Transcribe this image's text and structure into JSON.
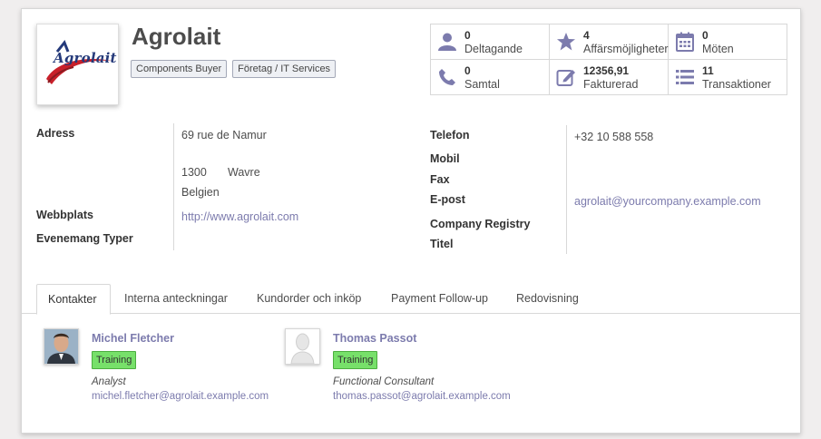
{
  "company": {
    "name": "Agrolait",
    "logo_text": "Agrolait",
    "tags": [
      "Components Buyer",
      "Företag / IT Services"
    ]
  },
  "stats": [
    {
      "icon": "user-icon",
      "count": "0",
      "label": "Deltagande"
    },
    {
      "icon": "star-icon",
      "count": "4",
      "label": "Affärsmöjligheter"
    },
    {
      "icon": "calendar-icon",
      "count": "0",
      "label": "Möten"
    },
    {
      "icon": "phone-icon",
      "count": "0",
      "label": "Samtal"
    },
    {
      "icon": "pencil-square-icon",
      "count": "12356,91",
      "label": "Fakturerad"
    },
    {
      "icon": "list-icon",
      "count": "11",
      "label": "Transaktioner"
    }
  ],
  "left_fields": {
    "address_label": "Adress",
    "street": "69 rue de Namur",
    "zip": "1300",
    "city": "Wavre",
    "country": "Belgien",
    "website_label": "Webbplats",
    "website": "http://www.agrolait.com",
    "event_types_label": "Evenemang Typer"
  },
  "right_fields": {
    "phone_label": "Telefon",
    "phone": "+32 10 588 558",
    "mobile_label": "Mobil",
    "fax_label": "Fax",
    "email_label": "E-post",
    "email": "agrolait@yourcompany.example.com",
    "registry_label": "Company Registry",
    "title_label": "Titel"
  },
  "tabs": [
    "Kontakter",
    "Interna anteckningar",
    "Kundorder och inköp",
    "Payment Follow-up",
    "Redovisning"
  ],
  "active_tab": "Kontakter",
  "contacts": [
    {
      "name": "Michel Fletcher",
      "badge": "Training",
      "role": "Analyst",
      "email": "michel.fletcher@agrolait.example.com"
    },
    {
      "name": "Thomas Passot",
      "badge": "Training",
      "role": "Functional Consultant",
      "email": "thomas.passot@agrolait.example.com"
    }
  ],
  "colors": {
    "accent": "#7c7bad",
    "badge": "#77e06a"
  }
}
